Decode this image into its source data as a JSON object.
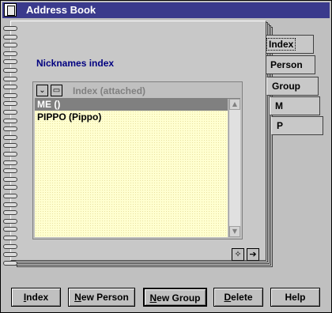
{
  "window": {
    "title": "Address Book"
  },
  "section": {
    "title": "Nicknames index"
  },
  "tabs": [
    {
      "label": "Index",
      "active": true
    },
    {
      "label": "Person",
      "active": false
    },
    {
      "label": "Group",
      "active": false
    },
    {
      "label": "M",
      "active": false
    },
    {
      "label": "P",
      "active": false
    }
  ],
  "listbox": {
    "header": "Index (attached)",
    "rows": [
      {
        "text": "ME ()",
        "selected": true
      },
      {
        "text": "PIPPO (Pippo)",
        "selected": false
      }
    ]
  },
  "buttons": {
    "index": {
      "mnemonic": "I",
      "rest": "ndex"
    },
    "new_person": {
      "mnemonic": "N",
      "rest": "ew Person"
    },
    "new_group": {
      "mnemonic": "N",
      "rest": "ew Group"
    },
    "delete": {
      "mnemonic": "D",
      "rest": "elete"
    },
    "help": {
      "label": "Help"
    }
  },
  "colors": {
    "titlebar": "#3a3a8c",
    "section_title": "#000080",
    "list_bg": "#ffffd0",
    "selection": "#808080"
  }
}
